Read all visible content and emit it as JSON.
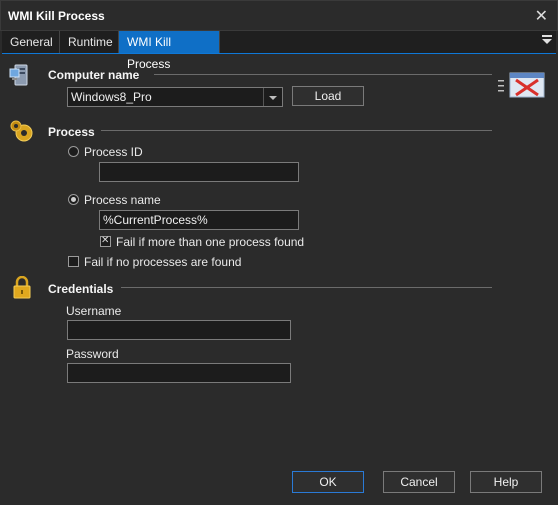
{
  "window": {
    "title": "WMI Kill Process"
  },
  "tabs": [
    {
      "label": "General"
    },
    {
      "label": "Runtime"
    },
    {
      "label": "WMI Kill Process"
    }
  ],
  "computer": {
    "heading": "Computer name",
    "value": "Windows8_Pro",
    "load_label": "Load"
  },
  "process": {
    "heading": "Process",
    "id_label": "Process ID",
    "id_value": "",
    "name_label": "Process name",
    "name_value": "%CurrentProcess%",
    "selected": "Process name",
    "fail_multiple_label": "Fail if more than one process found",
    "fail_multiple_checked": true,
    "fail_none_label": "Fail if no processes are found",
    "fail_none_checked": false
  },
  "credentials": {
    "heading": "Credentials",
    "username_label": "Username",
    "username_value": "",
    "password_label": "Password",
    "password_value": ""
  },
  "footer": {
    "ok_label": "OK",
    "cancel_label": "Cancel",
    "help_label": "Help"
  },
  "colors": {
    "accent": "#0f6fc6",
    "background": "#2b2b2b"
  },
  "icons": [
    "computer-icon",
    "gears-icon",
    "lock-icon",
    "wmi-kill-process-icon",
    "close-icon",
    "tab-menu-icon"
  ]
}
